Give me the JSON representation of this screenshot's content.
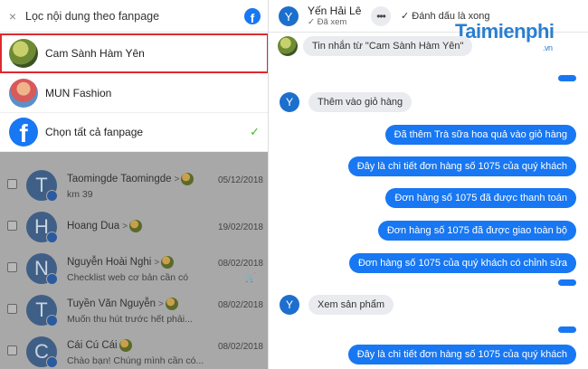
{
  "filter": {
    "title": "Lọc nội dung theo fanpage",
    "close_icon": "×",
    "fb_icon": "facebook-icon",
    "pages": [
      {
        "label": "Cam Sành Hàm Yên",
        "selected": true
      },
      {
        "label": "MUN Fashion",
        "selected": false
      },
      {
        "label": "Chọn tất cả fanpage",
        "selected": false,
        "check": "✓"
      }
    ]
  },
  "conversations": [
    {
      "initial": "T",
      "name": "Taomingde Taomingde",
      "snippet": "km 39",
      "date": "05/12/2018",
      "cart": ""
    },
    {
      "initial": "H",
      "name": "Hoang Dua",
      "snippet": "",
      "date": "19/02/2018",
      "cart": ""
    },
    {
      "initial": "N",
      "name": "Nguyễn Hoài Nghi",
      "snippet": "Checklist web cơ bản cần có",
      "date": "08/02/2018",
      "cart": "🛒"
    },
    {
      "initial": "T",
      "name": "Tuyền Văn Nguyễn",
      "snippet": "Muốn thu hút trước hết phải...",
      "date": "08/02/2018",
      "cart": ""
    },
    {
      "initial": "C",
      "name": "Cái Cú Cái",
      "snippet": "Chào bạn! Chúng mình cần có...",
      "date": "08/02/2018",
      "cart": ""
    }
  ],
  "chat": {
    "user_initial": "Y",
    "user_name": "Yến Hải Lê",
    "seen": "✓ Đã xem",
    "more": "•••",
    "mark_done": "✓ Đánh dấu là xong",
    "watermark": "Taimienphi",
    "watermark_tld": ".vn",
    "from_label": "Tin nhắn từ  \"Cam Sành Hàm Yên\"",
    "incoming_1": "Thêm vào giỏ hàng",
    "outgoing_1": [
      "Đã thêm Trà sữa hoa quả vào giỏ hàng",
      "Đây là chi tiết đơn hàng số 1075 của quý khách",
      "Đơn hàng số 1075 đã được thanh toán",
      "Đơn hàng số 1075 đã được giao toàn bộ",
      "Đơn hàng số 1075 của quý khách có chỉnh sửa"
    ],
    "incoming_2": "Xem sản phẩm",
    "outgoing_2": "Đây là chi tiết đơn hàng số 1075 của quý khách"
  }
}
